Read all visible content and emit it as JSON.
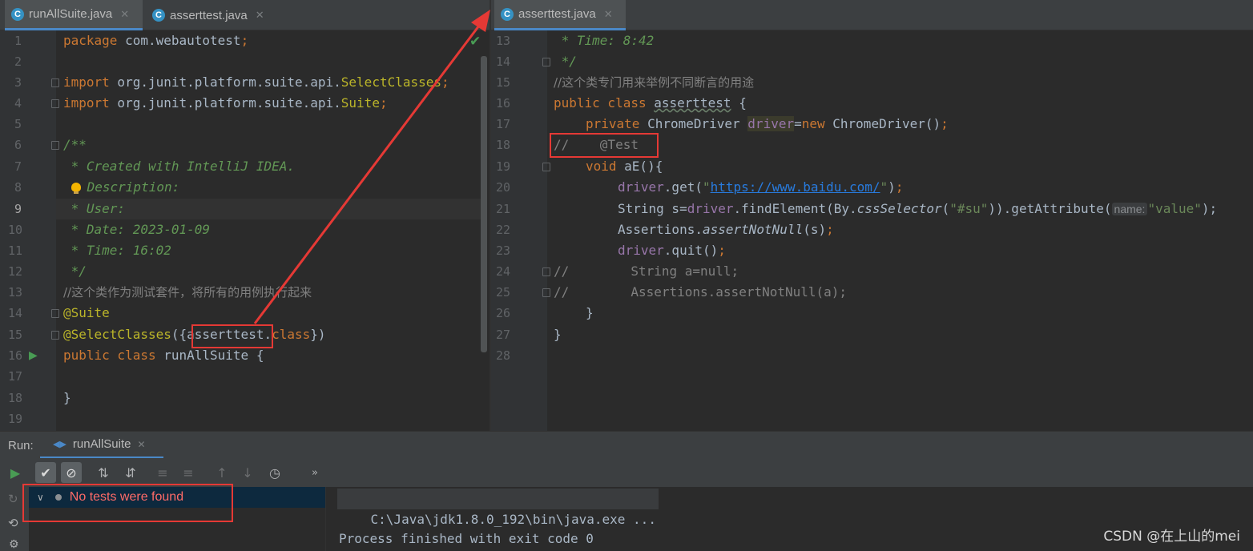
{
  "left_tabs": [
    {
      "label": "runAllSuite.java",
      "icon": "class-icon",
      "active": true
    },
    {
      "label": "asserttest.java",
      "icon": "class-icon",
      "active": false
    }
  ],
  "right_tabs": [
    {
      "label": "asserttest.java",
      "icon": "class-icon",
      "active": true
    }
  ],
  "tab_close_glyph": "✕",
  "class_icon_letter": "C",
  "left_editor": {
    "line_numbers": [
      "1",
      "2",
      "3",
      "4",
      "5",
      "6",
      "7",
      "8",
      "9",
      "10",
      "11",
      "12",
      "13",
      "14",
      "15",
      "16",
      "17",
      "18",
      "19"
    ],
    "current_line": "9",
    "lines": {
      "l1_kw": "package",
      "l1_rest": " com.webautotest",
      "semicolon": ";",
      "import_kw": "import",
      "l3_pkg": " org.junit.platform.suite.api.",
      "l3_ann": "SelectClasses",
      "l4_pkg": " org.junit.platform.suite.api.",
      "l4_ann": "Suite",
      "l6": "/**",
      "l7": " * Created with IntelliJ IDEA.",
      "l8": " Description:",
      "l9": " * User:",
      "l10": " * Date: 2023-01-09",
      "l11": " * Time: 16:02",
      "l12": " */",
      "l13": "//这个类作为测试套件，将所有的用例执行起来",
      "l14": "@Suite",
      "l15_ann": "@SelectClasses",
      "l15_open": "({",
      "l15_cls": "asserttest",
      "l15_dot": ".",
      "l15_class": "class",
      "l15_close": "})",
      "l16_kw": "public class",
      "l16_rest": " runAllSuite {",
      "l18": "}"
    }
  },
  "right_editor": {
    "line_numbers": [
      "13",
      "14",
      "15",
      "16",
      "17",
      "18",
      "19",
      "20",
      "21",
      "22",
      "23",
      "24",
      "25",
      "26",
      "27",
      "28"
    ],
    "lines": {
      "r13": " * Time: 8:42",
      "r14": " */",
      "r15": "//这个类专门用来举例不同断言的用途",
      "r16_kw": "public class",
      "r16_space": " ",
      "r16_name": "asserttest",
      "r16_brace": " {",
      "r17_kw": "private",
      "r17_type": " ChromeDriver ",
      "r17_fld": "driver",
      "r17_eq": "=",
      "r17_new": "new",
      "r17_rest": " ChromeDriver()",
      "r18": "//    @Test",
      "r19_kw": "void",
      "r19_rest": " aE(){",
      "r20_fld": "driver",
      "r20_a": ".get(",
      "r20_q1": "\"",
      "r20_url": "https://www.baidu.com/",
      "r20_q2": "\"",
      "r20_b": ")",
      "r21_a": "String s=",
      "r21_fld": "driver",
      "r21_b": ".findElement(By.",
      "r21_itl": "cssSelector",
      "r21_c": "(",
      "r21_str": "\"#su\"",
      "r21_d": ")).getAttribute(",
      "r21_hint": "name:",
      "r21_val": "\"value\"",
      "r21_e": ");",
      "r22_a": "Assertions.",
      "r22_itl": "assertNotNull",
      "r22_b": "(s)",
      "r23_fld": "driver",
      "r23_a": ".quit()",
      "r24": "//        String a=null;",
      "r25": "//        Assertions.assertNotNull(a);",
      "r26": "}",
      "r27": "}"
    }
  },
  "run_panel": {
    "label": "Run:",
    "tab": "runAllSuite",
    "tree_item": "No tests were found",
    "console_cmd": "C:\\Java\\jdk1.8.0_192\\bin\\java.exe ...",
    "console_exit": "Process finished with exit code 0"
  },
  "toolbar_icons": [
    "run-icon",
    "show-passed-icon",
    "show-ignored-icon",
    "sort-alpha-icon",
    "sort-duration-icon",
    "expand-all-icon",
    "collapse-all-icon",
    "prev-failed-icon",
    "next-failed-icon",
    "history-icon",
    "more-icon"
  ],
  "watermark": "CSDN @在上山的mei",
  "colors": {
    "background": "#2b2b2b",
    "keyword": "#cc7832",
    "annotation": "#bbb529",
    "comment": "#808080",
    "doc_comment": "#629755",
    "string": "#6a8759",
    "field": "#9876aa",
    "error_text": "#ff6b68",
    "highlight_box": "#e53935"
  }
}
